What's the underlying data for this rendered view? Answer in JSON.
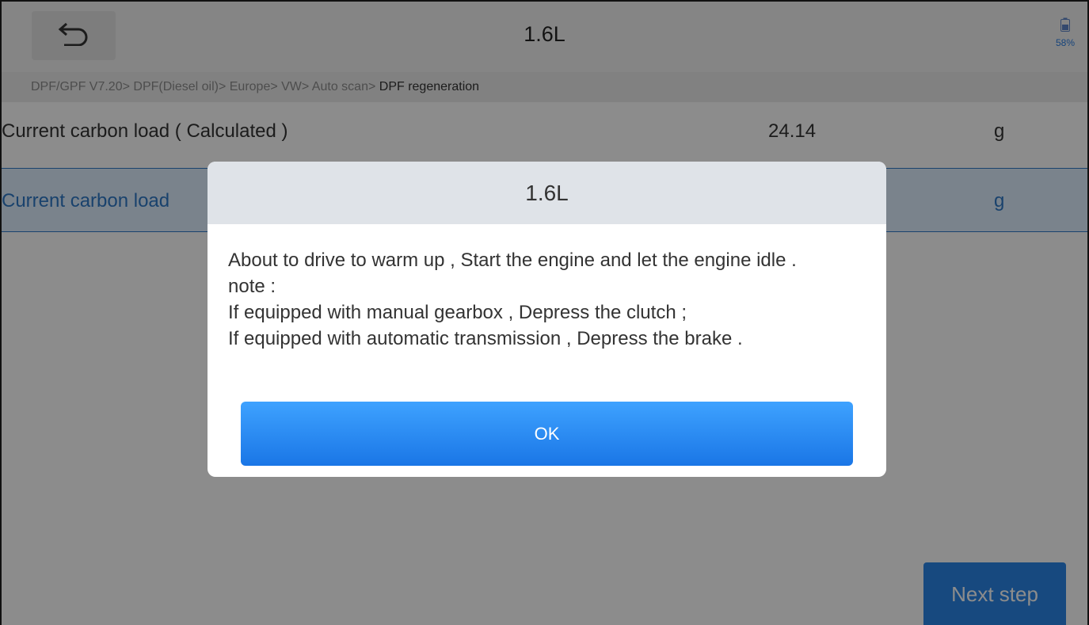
{
  "header": {
    "title": "1.6L",
    "battery_percent": "58%"
  },
  "breadcrumb": {
    "path": "DPF/GPF V7.20> DPF(Diesel oil)> Europe> VW> Auto scan>",
    "current": " DPF regeneration"
  },
  "rows": [
    {
      "name": "Current carbon load ( Calculated )",
      "value": "24.14",
      "unit": "g"
    },
    {
      "name": "Current carbon load",
      "value": "",
      "unit": "g"
    }
  ],
  "footer": {
    "next_label": "Next step"
  },
  "dialog": {
    "title": "1.6L",
    "lines": [
      "About to drive to warm up , Start the engine and let the engine idle .",
      "note :",
      "If equipped with manual gearbox , Depress the clutch ;",
      "If equipped with automatic transmission , Depress the brake ."
    ],
    "ok_label": "OK"
  },
  "colors": {
    "accent": "#2a86e8",
    "selected_row_text": "#2f79c6",
    "selected_row_bg": "#dfeeff"
  }
}
